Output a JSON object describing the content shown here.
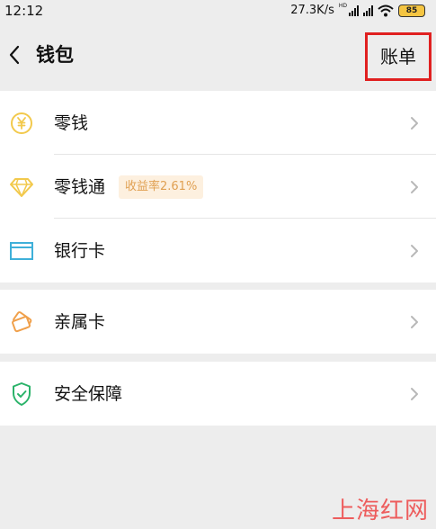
{
  "status_bar": {
    "time": "12:12",
    "network_speed": "27.3K/s",
    "network_badge": "HD",
    "battery_level": "85"
  },
  "nav": {
    "title": "钱包",
    "bill_label": "账单"
  },
  "menu": {
    "change": {
      "label": "零钱",
      "icon": "yuan-coin-icon"
    },
    "licaitong": {
      "label": "零钱通",
      "badge": "收益率2.61%",
      "icon": "diamond-icon"
    },
    "bank_card": {
      "label": "银行卡",
      "icon": "bank-card-icon"
    },
    "family_card": {
      "label": "亲属卡",
      "icon": "family-card-icon"
    },
    "security": {
      "label": "安全保障",
      "icon": "shield-check-icon"
    }
  },
  "colors": {
    "yellow_icon": "#f2c94c",
    "blue_icon": "#3fb0d9",
    "orange_icon": "#f0a04b",
    "green_icon": "#2bb36a",
    "highlight_border": "#e02020",
    "badge_text": "#e0a052",
    "badge_bg": "#fdf0df"
  },
  "watermark": "上海红网"
}
